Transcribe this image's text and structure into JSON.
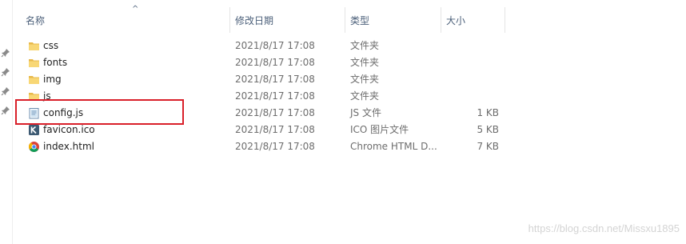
{
  "columns": [
    {
      "label": "名称"
    },
    {
      "label": "修改日期"
    },
    {
      "label": "类型"
    },
    {
      "label": "大小"
    }
  ],
  "sort_indicator": "^",
  "files": [
    {
      "name": "css",
      "date": "2021/8/17 17:08",
      "type": "文件夹",
      "size": "",
      "icon": "folder-icon"
    },
    {
      "name": "fonts",
      "date": "2021/8/17 17:08",
      "type": "文件夹",
      "size": "",
      "icon": "folder-icon"
    },
    {
      "name": "img",
      "date": "2021/8/17 17:08",
      "type": "文件夹",
      "size": "",
      "icon": "folder-icon"
    },
    {
      "name": "js",
      "date": "2021/8/17 17:08",
      "type": "文件夹",
      "size": "",
      "icon": "folder-icon"
    },
    {
      "name": "config.js",
      "date": "2021/8/17 17:08",
      "type": "JS 文件",
      "size": "1 KB",
      "icon": "js-file-icon"
    },
    {
      "name": "favicon.ico",
      "date": "2021/8/17 17:08",
      "type": "ICO 图片文件",
      "size": "5 KB",
      "icon": "ico-file-icon"
    },
    {
      "name": "index.html",
      "date": "2021/8/17 17:08",
      "type": "Chrome HTML D...",
      "size": "7 KB",
      "icon": "chrome-html-icon"
    }
  ],
  "watermark": "https://blog.csdn.net/Missxu1895",
  "colors": {
    "header_text": "#4c607a",
    "detail_text": "#6d6d6d",
    "highlight_border": "#d9202a",
    "folder": "#f8d775"
  }
}
